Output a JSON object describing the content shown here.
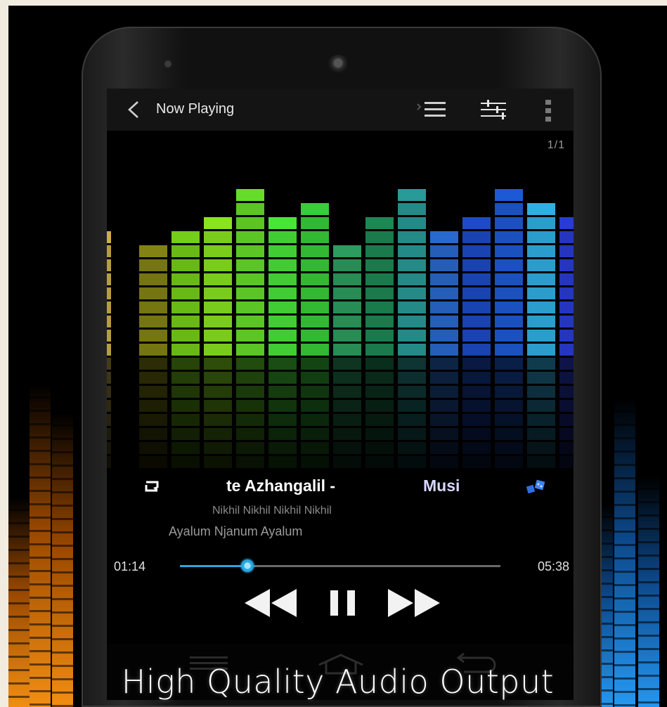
{
  "header": {
    "title": "Now Playing",
    "back_icon": "chevron-left-icon",
    "queue_icon": "playlist-icon",
    "equalizer_icon": "equalizer-sliders-icon",
    "menu_icon": "overflow-menu-icon"
  },
  "page_counter": "1/1",
  "visualizer": {
    "bar_levels": [
      9,
      8,
      9,
      10,
      12,
      10,
      11,
      8,
      10,
      12,
      9,
      10,
      12,
      11,
      10
    ],
    "max_level": 12,
    "colors": [
      "#d6b84c",
      "#8a8a14",
      "#7ad81a",
      "#8ef020",
      "#6be82c",
      "#4ef03c",
      "#3cd83c",
      "#2fa464",
      "#1f8f58",
      "#2aa2a0",
      "#2a6fd8",
      "#1d4fd0",
      "#1e5fe0",
      "#33b8f0",
      "#2a3fe0"
    ]
  },
  "track": {
    "title_fragment": "te Azhangalil -",
    "title_tail": "Musi",
    "artist": "Nikhil  Nikhil  Nikhil  Nikhil",
    "album": "Ayalum Njanum  Ayalum",
    "repeat_icon": "repeat-icon",
    "shuffle_icon": "shuffle-icon"
  },
  "progress": {
    "elapsed": "01:14",
    "total": "05:38",
    "fraction": 0.21
  },
  "controls": {
    "previous": "rewind-icon",
    "pause": "pause-icon",
    "next": "fast-forward-icon"
  },
  "nav": {
    "recents": "recents-icon",
    "home": "home-icon",
    "back": "back-arrow-icon"
  },
  "caption": "High Quality Audio Output",
  "colors": {
    "accent": "#2aa6e0",
    "background": "#000000",
    "page": "#f1ecdf"
  }
}
